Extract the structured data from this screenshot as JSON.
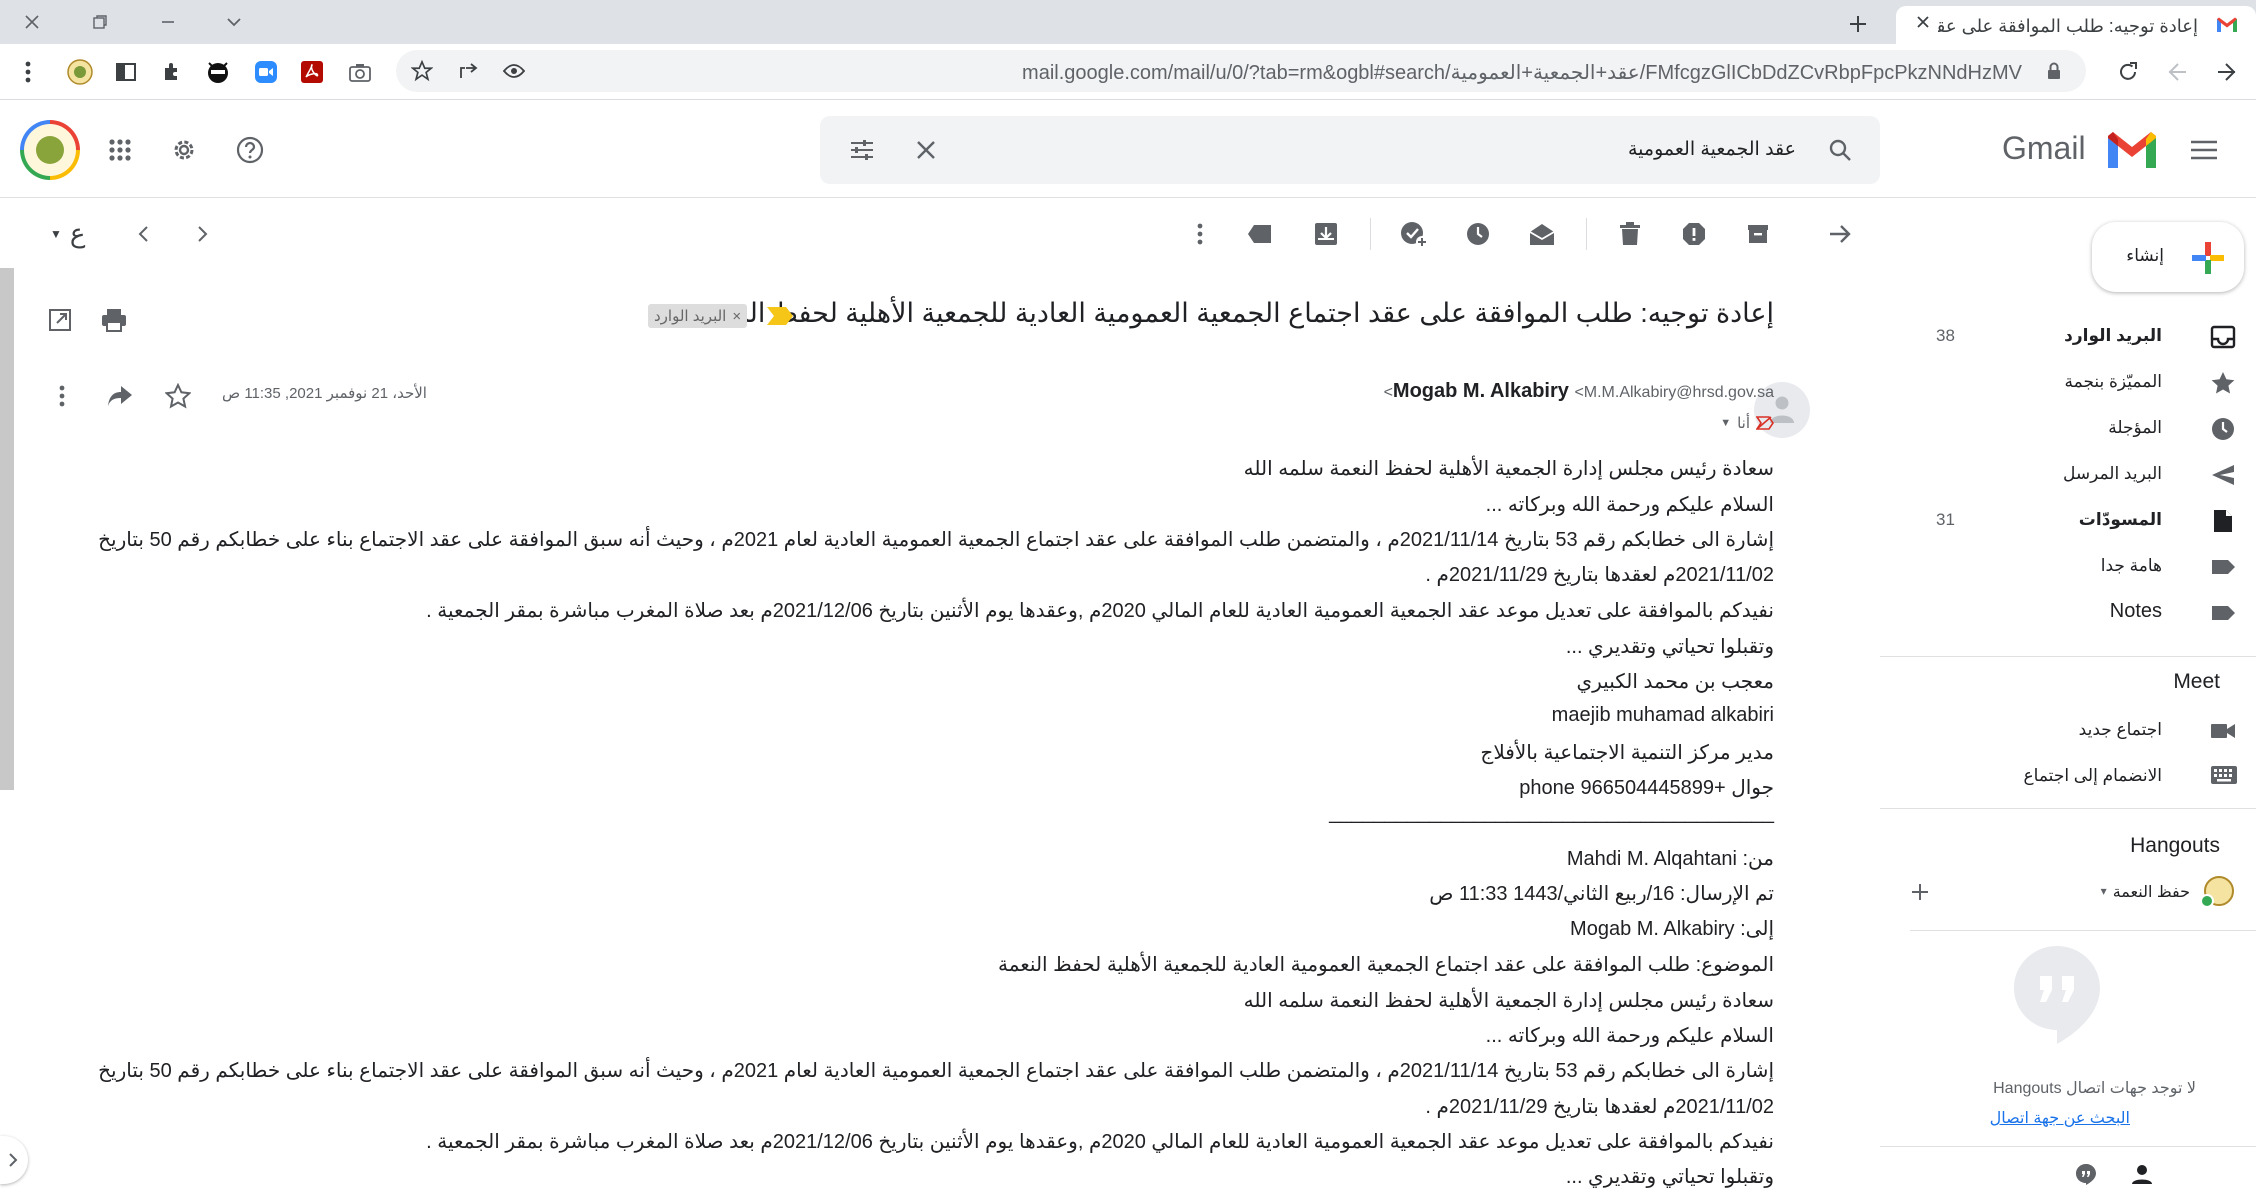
{
  "browser": {
    "tab_title": "إعادة توجيه: طلب الموافقة على عقد",
    "url": "mail.google.com/mail/u/0/?tab=rm&ogbl#search/عقد+الجمعية+العمومية/FMfcgzGlICbDdZCvRbpFpcPkzNNdHzMV"
  },
  "header": {
    "product_name": "Gmail",
    "search_value": "عقد الجمعية العمومية"
  },
  "sidebar": {
    "compose_label": "إنشاء",
    "items": [
      {
        "label": "البريد الوارد",
        "count": "38",
        "icon": "inbox-icon",
        "bold": true
      },
      {
        "label": "المميّزة بنجمة",
        "count": "",
        "icon": "star-icon",
        "bold": false
      },
      {
        "label": "المؤجلة",
        "count": "",
        "icon": "clock-icon",
        "bold": false
      },
      {
        "label": "البريد المرسل",
        "count": "",
        "icon": "send-icon",
        "bold": false
      },
      {
        "label": "المسودّات",
        "count": "31",
        "icon": "draft-icon",
        "bold": true
      },
      {
        "label": "هامة جدا",
        "count": "",
        "icon": "label-icon",
        "bold": false
      },
      {
        "label": "Notes",
        "count": "",
        "icon": "label-icon",
        "bold": false
      }
    ],
    "meet_title": "Meet",
    "meet_items": [
      "اجتماع جديد",
      "الانضمام إلى اجتماع"
    ],
    "hangouts_title": "Hangouts",
    "hangouts_user": "حفظ النعمة",
    "no_contacts": "لا توجد جهات اتصال Hangouts",
    "find_contact": "البحث عن جهة اتصال"
  },
  "toolbar": {
    "pagination_label": "ع"
  },
  "thread": {
    "subject": "إعادة توجيه: طلب الموافقة على عقد اجتماع الجمعية العمومية العادية للجمعية الأهلية لحفظ النعمة",
    "label_badge": "البريد الوارد",
    "sender_name": "Mogab M. Alkabiry",
    "sender_email": "<M.M.Alkabiry@hrsd.gov.sa>",
    "date": "الأحد، 21 نوفمبر 2021, 11:35 ص",
    "to_me": "أنا",
    "body_lines": [
      "سعادة رئيس مجلس إدارة الجمعية الأهلية لحفظ النعمة                       سلمه الله",
      "   السلام عليكم ورحمة الله وبركاته ...",
      "إشارة الى خطابكم رقم 53 بتاريخ 2021/11/14م ، والمتضمن طلب الموافقة على عقد اجتماع الجمعية العمومية العادية لعام 2021م ، وحيث أنه سبق الموافقة على عقد الاجتماع بناء على خطابكم رقم 50 بتاريخ",
      "2021/11/02م لعقدها بتاريخ 2021/11/29م .",
      "نفيدكم بالموافقة على تعديل موعد عقد الجمعية العمومية العادية للعام المالي 2020م ,وعقدها يوم الأثنين بتاريخ 2021/12/06م بعد صلاة المغرب مباشرة بمقر الجمعية .",
      "وتقبلوا تحياتي وتقديري ...",
      "معجب بن محمد الكبيري",
      "maejib muhamad alkabiri",
      "مدير مركز التنمية الاجتماعية بالأفلاج",
      "جوال  +966504445899  phone",
      "________________________________________",
      "من: Mahdi M. Alqahtani",
      "تم الإرسال: 16/ربيع الثاني/1443 11:33 ص",
      "إلى: Mogab M. Alkabiry",
      "الموضوع: طلب الموافقة على عقد اجتماع الجمعية العمومية العادية للجمعية الأهلية لحفظ النعمة",
      "سعادة رئيس مجلس إدارة الجمعية الأهلية لحفظ النعمة                       سلمه الله",
      "   السلام عليكم ورحمة الله وبركاته ...",
      "إشارة الى خطابكم رقم 53 بتاريخ 2021/11/14م ، والمتضمن طلب الموافقة على عقد اجتماع الجمعية العمومية العادية لعام 2021م ، وحيث أنه سبق الموافقة على عقد الاجتماع بناء على خطابكم رقم 50 بتاريخ",
      "2021/11/02م لعقدها بتاريخ 2021/11/29م .",
      "نفيدكم بالموافقة على تعديل موعد عقد الجمعية العمومية العادية للعام المالي 2020م ,وعقدها يوم الأثنين بتاريخ 2021/12/06م بعد صلاة المغرب مباشرة بمقر الجمعية .",
      "وتقبلوا تحياتي وتقديري ..."
    ]
  },
  "colors": {
    "gmail_red": "#ea4335",
    "gmail_blue": "#4285f4",
    "gmail_green": "#34a853",
    "gmail_yellow": "#fbbc04",
    "label_yellow": "#f5c518",
    "icon_gray": "#5f6368"
  }
}
